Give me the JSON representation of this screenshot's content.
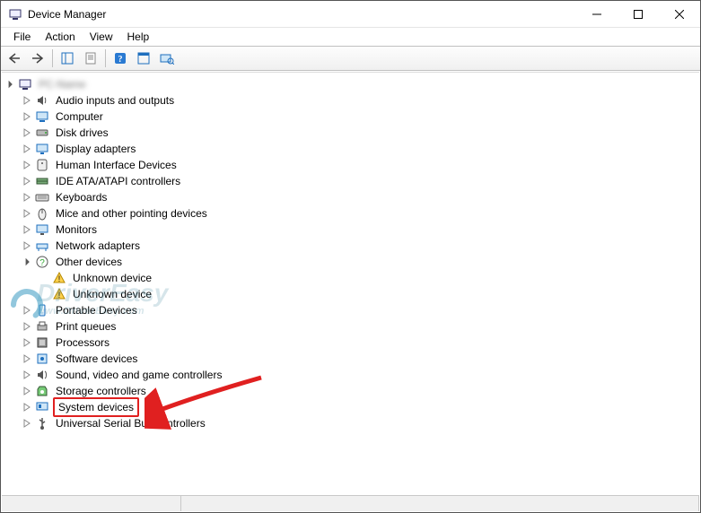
{
  "window": {
    "title": "Device Manager"
  },
  "menus": {
    "file": "File",
    "action": "Action",
    "view": "View",
    "help": "Help"
  },
  "toolbar": {
    "back": "back-icon",
    "forward": "forward-icon",
    "show_hide_tree": "show-hide-console-tree-icon",
    "properties": "properties-icon",
    "help": "help-icon",
    "action_center": "action-icon",
    "scan": "scan-hardware-icon"
  },
  "tree": {
    "root": {
      "label": "PC-Name",
      "expanded": true,
      "children": [
        {
          "label": "Audio inputs and outputs",
          "icon": "speaker-icon",
          "expanded": false
        },
        {
          "label": "Computer",
          "icon": "computer-icon",
          "expanded": false
        },
        {
          "label": "Disk drives",
          "icon": "disk-icon",
          "expanded": false
        },
        {
          "label": "Display adapters",
          "icon": "display-icon",
          "expanded": false
        },
        {
          "label": "Human Interface Devices",
          "icon": "hid-icon",
          "expanded": false
        },
        {
          "label": "IDE ATA/ATAPI controllers",
          "icon": "ide-icon",
          "expanded": false
        },
        {
          "label": "Keyboards",
          "icon": "keyboard-icon",
          "expanded": false
        },
        {
          "label": "Mice and other pointing devices",
          "icon": "mouse-icon",
          "expanded": false
        },
        {
          "label": "Monitors",
          "icon": "monitor-icon",
          "expanded": false
        },
        {
          "label": "Network adapters",
          "icon": "network-icon",
          "expanded": false
        },
        {
          "label": "Other devices",
          "icon": "other-icon",
          "expanded": true,
          "children": [
            {
              "label": "Unknown device",
              "icon": "warning-icon"
            },
            {
              "label": "Unknown device",
              "icon": "warning-icon"
            }
          ]
        },
        {
          "label": "Portable Devices",
          "icon": "portable-icon",
          "expanded": false
        },
        {
          "label": "Print queues",
          "icon": "printer-icon",
          "expanded": false
        },
        {
          "label": "Processors",
          "icon": "cpu-icon",
          "expanded": false
        },
        {
          "label": "Software devices",
          "icon": "software-icon",
          "expanded": false
        },
        {
          "label": "Sound, video and game controllers",
          "icon": "sound-icon",
          "expanded": false
        },
        {
          "label": "Storage controllers",
          "icon": "storage-icon",
          "expanded": false
        },
        {
          "label": "System devices",
          "icon": "system-icon",
          "expanded": false,
          "highlight": true
        },
        {
          "label": "Universal Serial Bus controllers",
          "icon": "usb-icon",
          "expanded": false
        }
      ]
    }
  },
  "watermark": {
    "brand": "DriverEasy",
    "url": "www.DriverEasy.com"
  }
}
